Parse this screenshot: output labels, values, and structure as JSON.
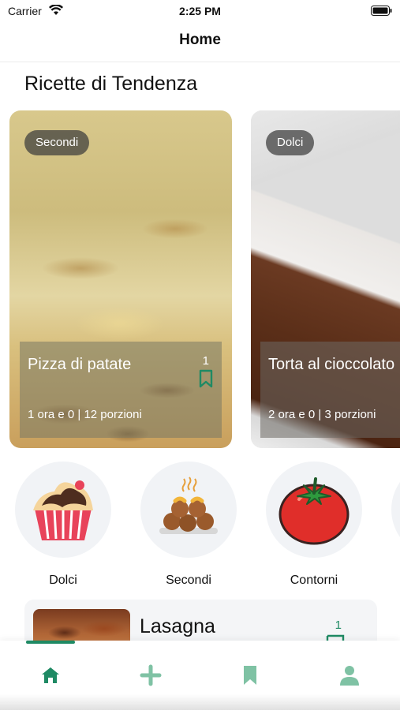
{
  "status_bar": {
    "carrier": "Carrier",
    "time": "2:25 PM"
  },
  "nav": {
    "title": "Home"
  },
  "trending": {
    "title": "Ricette di Tendenza",
    "cards": [
      {
        "category": "Secondi",
        "title": "Pizza di patate",
        "meta": "1 ora e 0  | 12 porzioni",
        "saves": "1"
      },
      {
        "category": "Dolci",
        "title": "Torta al cioccolato",
        "meta": "2 ora e 0  | 3 porzioni",
        "saves": ""
      }
    ]
  },
  "categories": [
    {
      "label": "Dolci",
      "icon": "cupcake-icon"
    },
    {
      "label": "Secondi",
      "icon": "meatballs-icon"
    },
    {
      "label": "Contorni",
      "icon": "tomato-icon"
    }
  ],
  "recipes": [
    {
      "title": "Lasagna",
      "saves": "1"
    }
  ],
  "tabs": [
    {
      "name": "home",
      "icon": "home-icon",
      "active": true
    },
    {
      "name": "add",
      "icon": "plus-icon",
      "active": false
    },
    {
      "name": "bookmarks",
      "icon": "bookmark-icon",
      "active": false
    },
    {
      "name": "profile",
      "icon": "user-icon",
      "active": false
    }
  ],
  "colors": {
    "accent": "#1f8a64",
    "tab_inactive": "#7fc2a4",
    "pill_bg": "#3c3c3c"
  }
}
